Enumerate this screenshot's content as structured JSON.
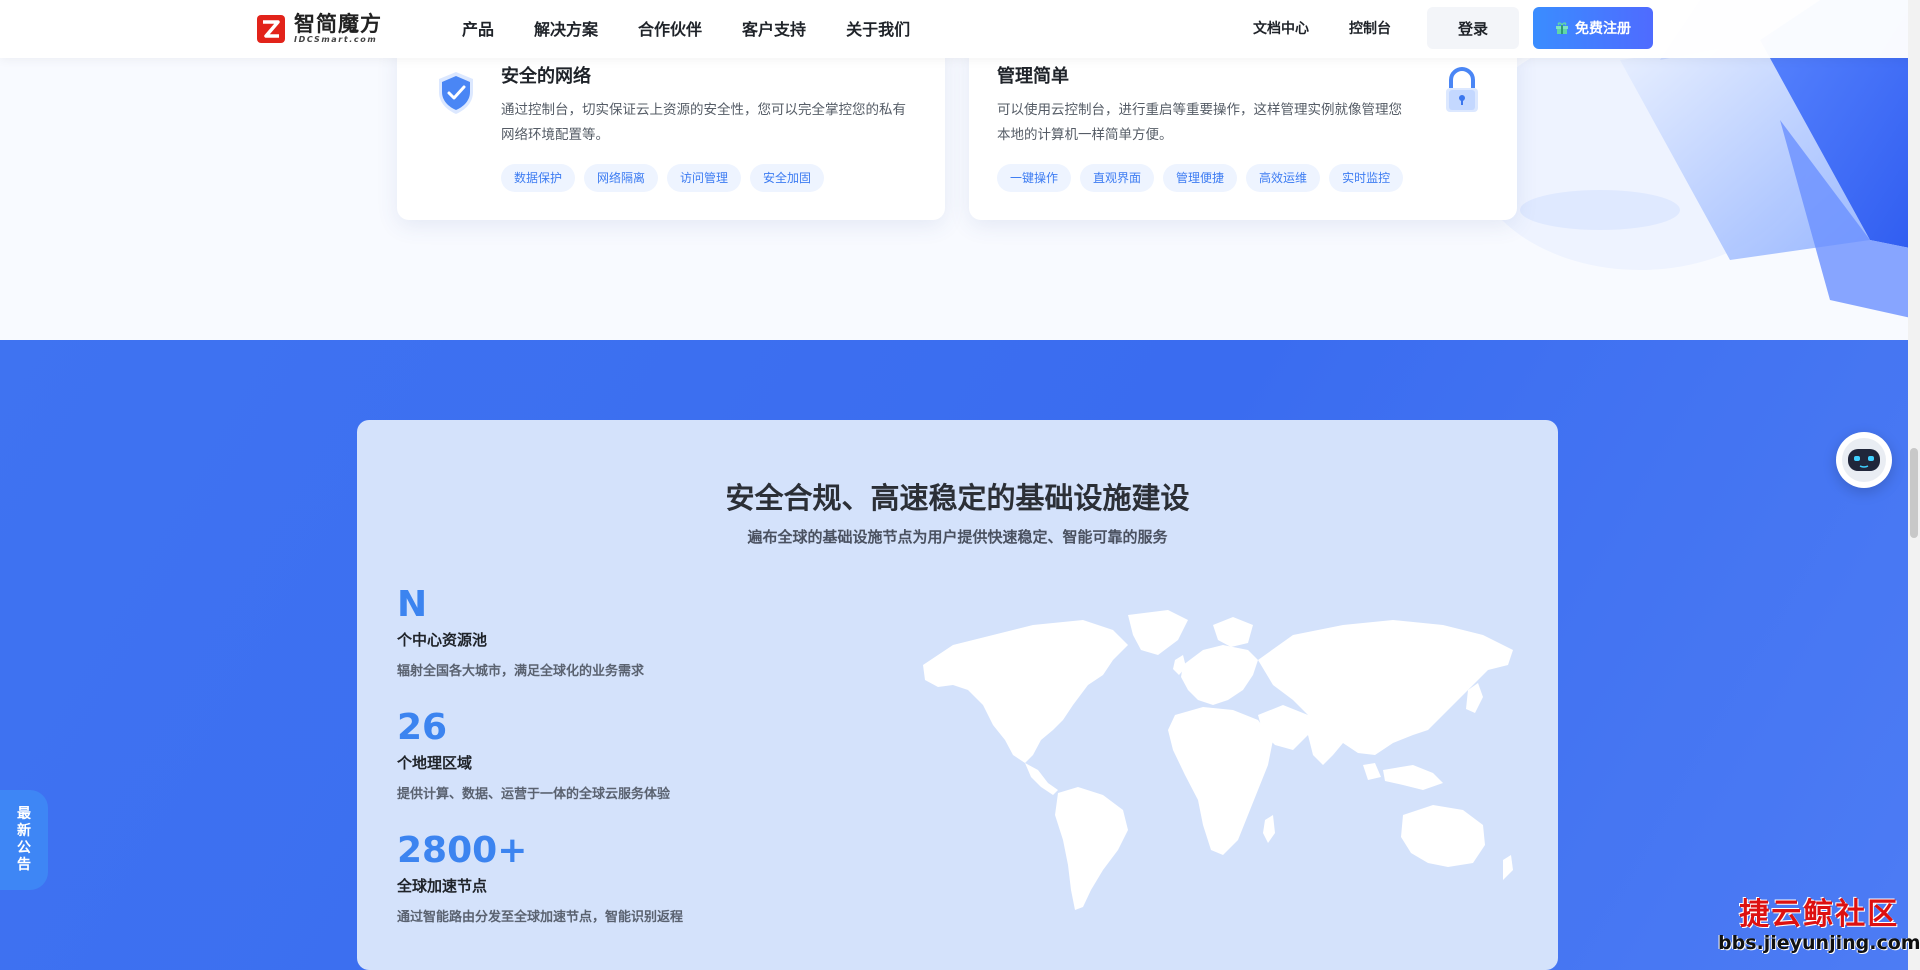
{
  "header": {
    "logo_cn": "智简魔方",
    "logo_en": "IDCSmart.com",
    "nav": [
      "产品",
      "解决方案",
      "合作伙伴",
      "客户支持",
      "关于我们"
    ],
    "docs": "文档中心",
    "console": "控制台",
    "login": "登录",
    "register": "免费注册"
  },
  "features": [
    {
      "title": "安全的网络",
      "desc": "通过控制台，切实保证云上资源的安全性，您可以完全掌控您的私有网络环境配置等。",
      "tags": [
        "数据保护",
        "网络隔离",
        "访问管理",
        "安全加固"
      ],
      "icon": "shield-check-icon"
    },
    {
      "title": "管理简单",
      "desc": "可以使用云控制台，进行重启等重要操作，这样管理实例就像管理您本地的计算机一样简单方便。",
      "tags": [
        "一键操作",
        "直观界面",
        "管理便捷",
        "高效运维",
        "实时监控"
      ],
      "icon": "lock-icon"
    }
  ],
  "infra": {
    "title": "安全合规、高速稳定的基础设施建设",
    "subtitle": "遍布全球的基础设施节点为用户提供快速稳定、智能可靠的服务",
    "stats": [
      {
        "value": "N",
        "label": "个中心资源池",
        "desc": "辐射全国各大城市，满足全球化的业务需求"
      },
      {
        "value": "26",
        "label": "个地理区域",
        "desc": "提供计算、数据、运营于一体的全球云服务体验"
      },
      {
        "value": "2800+",
        "label": "全球加速节点",
        "desc": "通过智能路由分发至全球加速节点，智能识别返程"
      }
    ]
  },
  "notice_tab": [
    "最",
    "新",
    "公",
    "告"
  ],
  "watermark": {
    "cn": "捷云鲸社区",
    "en": "bbs.jieyunjing.com"
  },
  "colors": {
    "accent": "#3c84f0",
    "section_bg": "#3f73f1",
    "panel_bg": "#d4e2fb",
    "tag_text": "#3d7cf2"
  }
}
